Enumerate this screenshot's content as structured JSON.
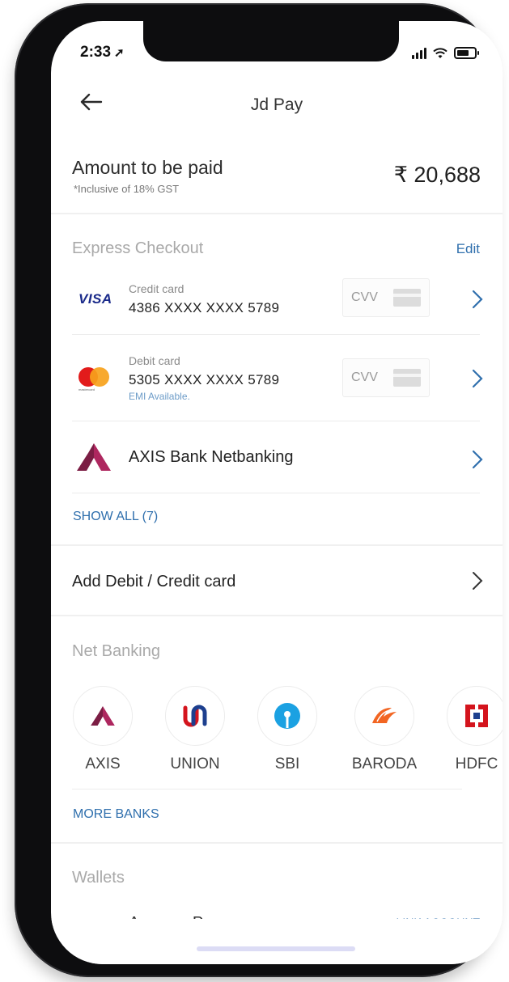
{
  "status_bar": {
    "time": "2:33"
  },
  "header": {
    "title": "Jd Pay"
  },
  "amount": {
    "label": "Amount to be paid",
    "note": "*Inclusive of 18% GST",
    "value": "₹ 20,688"
  },
  "express": {
    "title": "Express Checkout",
    "edit_label": "Edit",
    "cards": [
      {
        "brand": "VISA",
        "type": "Credit card",
        "number": "4386 XXXX XXXX 5789",
        "cvv_label": "CVV"
      },
      {
        "brand": "mastercard",
        "type": "Debit card",
        "number": "5305 XXXX XXXX 5789",
        "note": "EMI Available.",
        "cvv_label": "CVV"
      }
    ],
    "netbanking_label": "AXIS Bank Netbanking",
    "show_all": "SHOW ALL (7)"
  },
  "add_card": {
    "label": "Add Debit / Credit card"
  },
  "net_banking": {
    "title": "Net Banking",
    "banks": [
      {
        "name": "AXIS"
      },
      {
        "name": "UNION"
      },
      {
        "name": "SBI"
      },
      {
        "name": "BARODA"
      },
      {
        "name": "HDFC"
      }
    ],
    "more_banks": "MORE BANKS"
  },
  "wallets": {
    "title": "Wallets",
    "items": [
      {
        "logo": "pay",
        "name": "Amazon Pay",
        "action": "LINK ACCOUNT"
      }
    ]
  },
  "colors": {
    "link": "#2f6fad",
    "axis": "#ae275f",
    "sbi": "#1ba1e2",
    "hdfc": "#d4141d",
    "baroda": "#f26522"
  }
}
